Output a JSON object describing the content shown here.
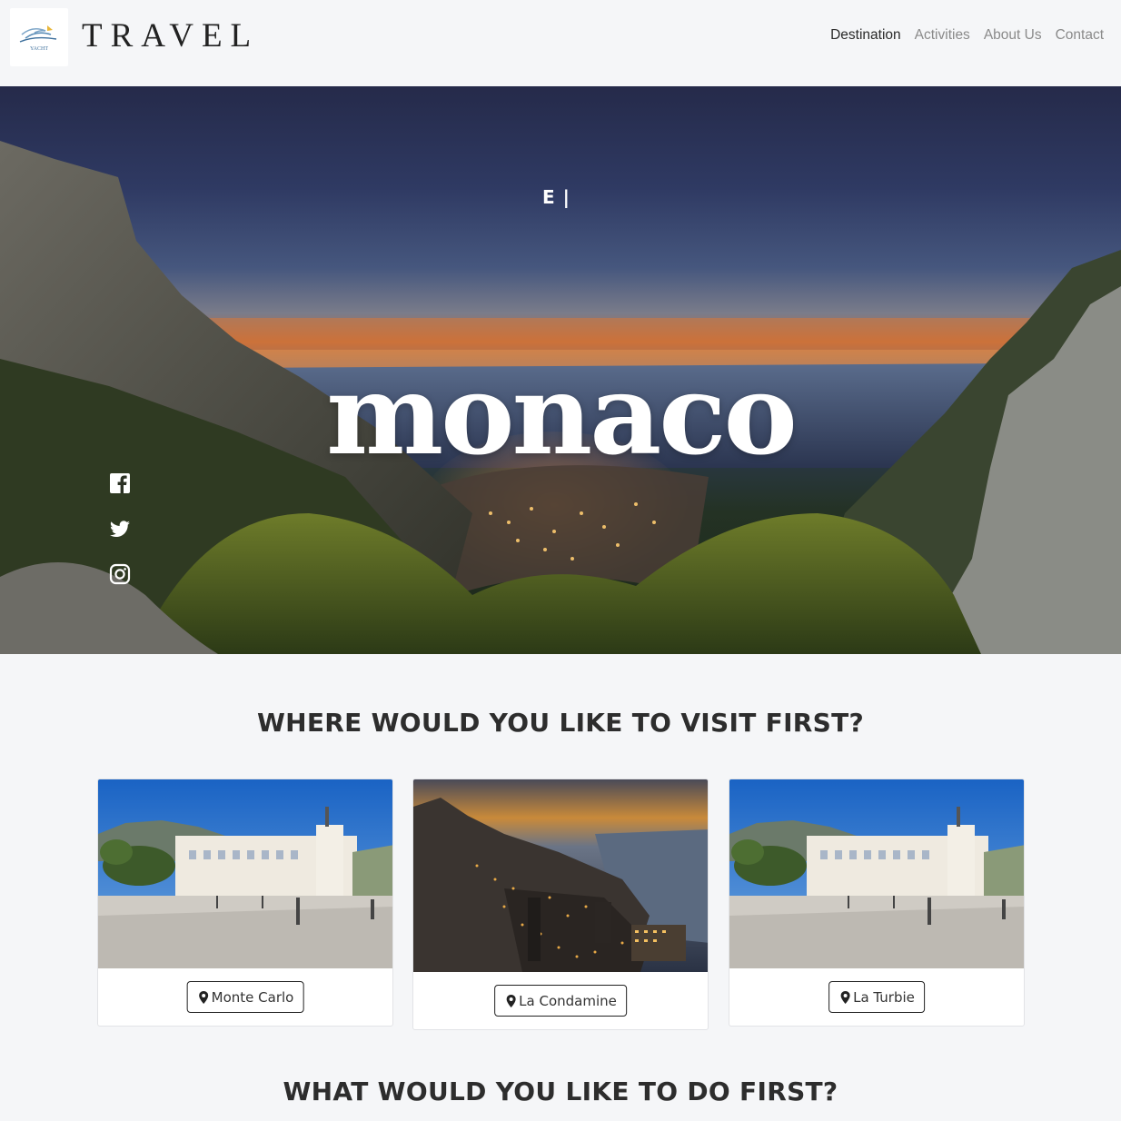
{
  "brand": {
    "logo_text": "YACHT",
    "name": "TRAVEL"
  },
  "nav": {
    "items": [
      {
        "label": "Destination",
        "active": true
      },
      {
        "label": "Activities",
        "active": false
      },
      {
        "label": "About Us",
        "active": false
      },
      {
        "label": "Contact",
        "active": false
      }
    ]
  },
  "hero": {
    "typed_text": "E |",
    "title": "monaco",
    "socials": [
      "facebook-icon",
      "twitter-icon",
      "instagram-icon"
    ]
  },
  "visit": {
    "heading": "WHERE WOULD YOU LIKE TO VISIT FIRST?",
    "places": [
      {
        "label": "Monte Carlo",
        "icon": "map-pin-icon"
      },
      {
        "label": "La Condamine",
        "icon": "map-pin-icon"
      },
      {
        "label": "La Turbie",
        "icon": "map-pin-icon"
      }
    ]
  },
  "activities": {
    "heading": "WHAT WOULD YOU LIKE TO DO FIRST?"
  },
  "colors": {
    "page_bg": "#f5f6f8",
    "text": "#2d2d2d",
    "nav_inactive": "#8a8a8a",
    "hero_title": "#ffffff"
  }
}
